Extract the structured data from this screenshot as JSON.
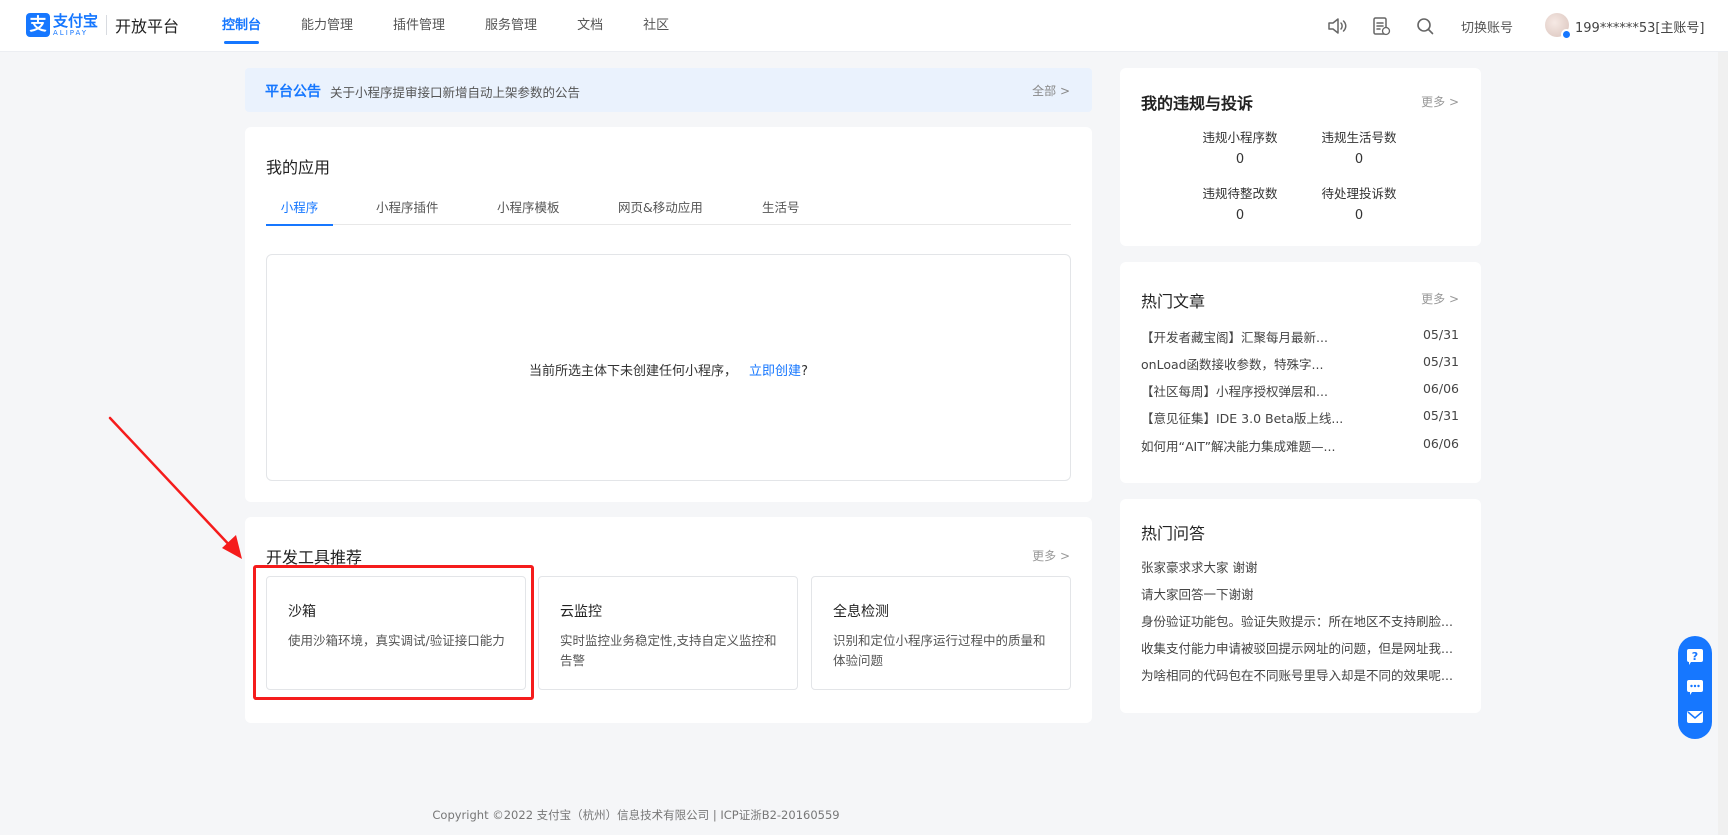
{
  "header": {
    "logo_cn": "支付宝",
    "logo_en": "ALIPAY",
    "platform": "开放平台",
    "nav": [
      "控制台",
      "能力管理",
      "插件管理",
      "服务管理",
      "文档",
      "社区"
    ],
    "active_nav": "控制台",
    "switch_account": "切换账号",
    "account": "199******53[主账号]"
  },
  "announcement": {
    "label": "平台公告",
    "text": "关于小程序提审接口新增自动上架参数的公告",
    "all": "全部 >"
  },
  "my_apps": {
    "title": "我的应用",
    "tabs": [
      "小程序",
      "小程序插件",
      "小程序模板",
      "网页&移动应用",
      "生活号"
    ],
    "empty_text": "当前所选主体下未创建任何小程序，",
    "create_link": "立即创建",
    "create_suffix": "?"
  },
  "dev_tools": {
    "title": "开发工具推荐",
    "more": "更多 >",
    "tools": [
      {
        "name": "沙箱",
        "desc": "使用沙箱环境，真实调试/验证接口能力"
      },
      {
        "name": "云监控",
        "desc": "实时监控业务稳定性,支持自定义监控和告警"
      },
      {
        "name": "全息检测",
        "desc": "识别和定位小程序运行过程中的质量和体验问题"
      }
    ]
  },
  "violations": {
    "title": "我的违规与投诉",
    "more": "更多 >",
    "stats": [
      {
        "label": "违规小程序数",
        "value": "0"
      },
      {
        "label": "违规生活号数",
        "value": "0"
      },
      {
        "label": "违规待整改数",
        "value": "0"
      },
      {
        "label": "待处理投诉数",
        "value": "0"
      }
    ]
  },
  "hot_articles": {
    "title": "热门文章",
    "more": "更多 >",
    "items": [
      {
        "title": "【开发者藏宝阁】汇聚每月最新...",
        "date": "05/31"
      },
      {
        "title": "onLoad函数接收参数，特殊字...",
        "date": "05/31"
      },
      {
        "title": "【社区每周】小程序授权弹层和...",
        "date": "06/06"
      },
      {
        "title": "【意见征集】IDE 3.0 Beta版上线...",
        "date": "05/31"
      },
      {
        "title": "如何用“AIT”解决能力集成难题—...",
        "date": "06/06"
      }
    ]
  },
  "hot_qa": {
    "title": "热门问答",
    "items": [
      "张家豪求求大家 谢谢",
      "请大家回答一下谢谢",
      "身份验证功能包。验证失败提示：所在地区不支持刷脸...",
      "收集支付能力申请被驳回提示网址的问题，但是网址我...",
      "为啥相同的代码包在不同账号里导入却是不同的效果呢..."
    ]
  },
  "footer": "Copyright ©2022 支付宝（杭州）信息技术有限公司  |  ICP证浙B2-20160559",
  "colors": {
    "accent": "#1677ff",
    "highlight": "#f51c1c"
  },
  "icons": [
    "speaker-icon",
    "document-icon",
    "search-icon",
    "help-icon",
    "chat-icon",
    "feedback-icon"
  ]
}
